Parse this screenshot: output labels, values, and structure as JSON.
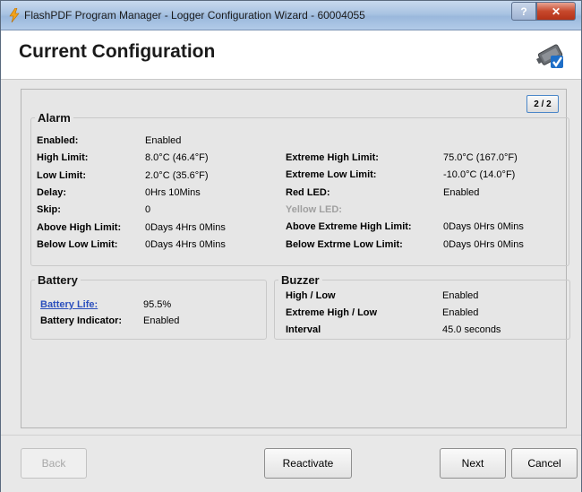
{
  "window": {
    "title": "FlashPDF Program Manager - Logger Configuration Wizard - 60004055",
    "help_label": "?",
    "close_label": "✕"
  },
  "header": {
    "title": "Current Configuration"
  },
  "page_indicator": "2 / 2",
  "alarm": {
    "legend": "Alarm",
    "left": [
      {
        "label": "Enabled:",
        "value": "Enabled"
      },
      {
        "label": "High Limit:",
        "value": "8.0°C (46.4°F)"
      },
      {
        "label": "Low Limit:",
        "value": "2.0°C (35.6°F)"
      },
      {
        "label": "Delay:",
        "value": "0Hrs 10Mins"
      },
      {
        "label": "Skip:",
        "value": "0"
      },
      {
        "label": "Above High Limit:",
        "value": "0Days 4Hrs 0Mins"
      },
      {
        "label": "Below Low Limit:",
        "value": "0Days 4Hrs 0Mins"
      }
    ],
    "right": [
      {
        "label": "Extreme High Limit:",
        "value": "75.0°C (167.0°F)"
      },
      {
        "label": "Extreme Low Limit:",
        "value": "-10.0°C (14.0°F)"
      },
      {
        "label": "Red LED:",
        "value": "Enabled"
      },
      {
        "label": "Yellow LED:",
        "value": ""
      },
      {
        "label": "Above Extreme High Limit:",
        "value": "0Days 0Hrs 0Mins"
      },
      {
        "label": "Below Extrme Low Limit:",
        "value": "0Days 0Hrs 0Mins"
      }
    ]
  },
  "battery": {
    "legend": "Battery",
    "life_label": "Battery Life:",
    "life_value": "95.5%",
    "indicator_label": "Battery Indicator:",
    "indicator_value": "Enabled"
  },
  "buzzer": {
    "legend": "Buzzer",
    "rows": [
      {
        "label": "High / Low",
        "value": "Enabled"
      },
      {
        "label": "Extreme High / Low",
        "value": "Enabled"
      },
      {
        "label": "Interval",
        "value": "45.0 seconds"
      }
    ]
  },
  "footer": {
    "back": "Back",
    "reactivate": "Reactivate",
    "next": "Next",
    "cancel": "Cancel"
  }
}
